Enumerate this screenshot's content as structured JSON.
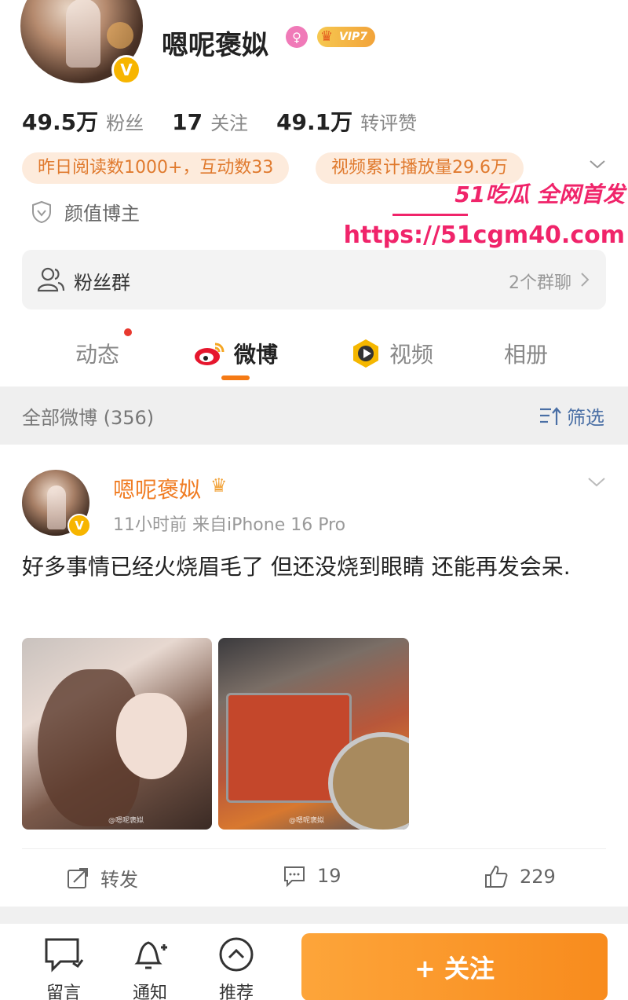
{
  "profile": {
    "username": "嗯呢褒姒",
    "vip_label": "VIP7",
    "stats": [
      {
        "value": "49.5万",
        "label": "粉丝"
      },
      {
        "value": "17",
        "label": "关注"
      },
      {
        "value": "49.1万",
        "label": "转评赞"
      }
    ],
    "pills": [
      "昨日阅读数1000+，互动数33",
      "视频累计播放量29.6万"
    ],
    "badge_label": "颜值博主"
  },
  "watermark": {
    "line1": "51吃瓜 全网首发",
    "line2": "https://51cgm40.com"
  },
  "fans_group": {
    "label": "粉丝群",
    "count": "2个群聊"
  },
  "tabs": [
    {
      "label": "动态",
      "icon": "dot-icon"
    },
    {
      "label": "微博",
      "icon": "weibo-icon",
      "active": true
    },
    {
      "label": "视频",
      "icon": "video-icon"
    },
    {
      "label": "相册",
      "icon": ""
    }
  ],
  "filter": {
    "label": "全部微博 (356)",
    "filter_label": "筛选"
  },
  "post": {
    "username": "嗯呢褒姒",
    "meta": "11小时前  来自iPhone 16 Pro",
    "text": "好多事情已经火烧眉毛了 但还没烧到眼睛 还能再发会呆.",
    "photo_watermark_1": "@嗯呢褒姒",
    "photo_watermark_2": "@嗯呢褒姒",
    "actions": {
      "repost": "转发",
      "comments": "19",
      "likes": "229"
    }
  },
  "bottom_bar": {
    "message": "留言",
    "notify": "通知",
    "recommend": "推荐",
    "follow": "+ 关注"
  },
  "colors": {
    "accent": "#f88b1d",
    "username_orange": "#f07d24",
    "pill_bg": "#fdebdc",
    "watermark": "#f0246a",
    "verified": "#f7b500"
  }
}
